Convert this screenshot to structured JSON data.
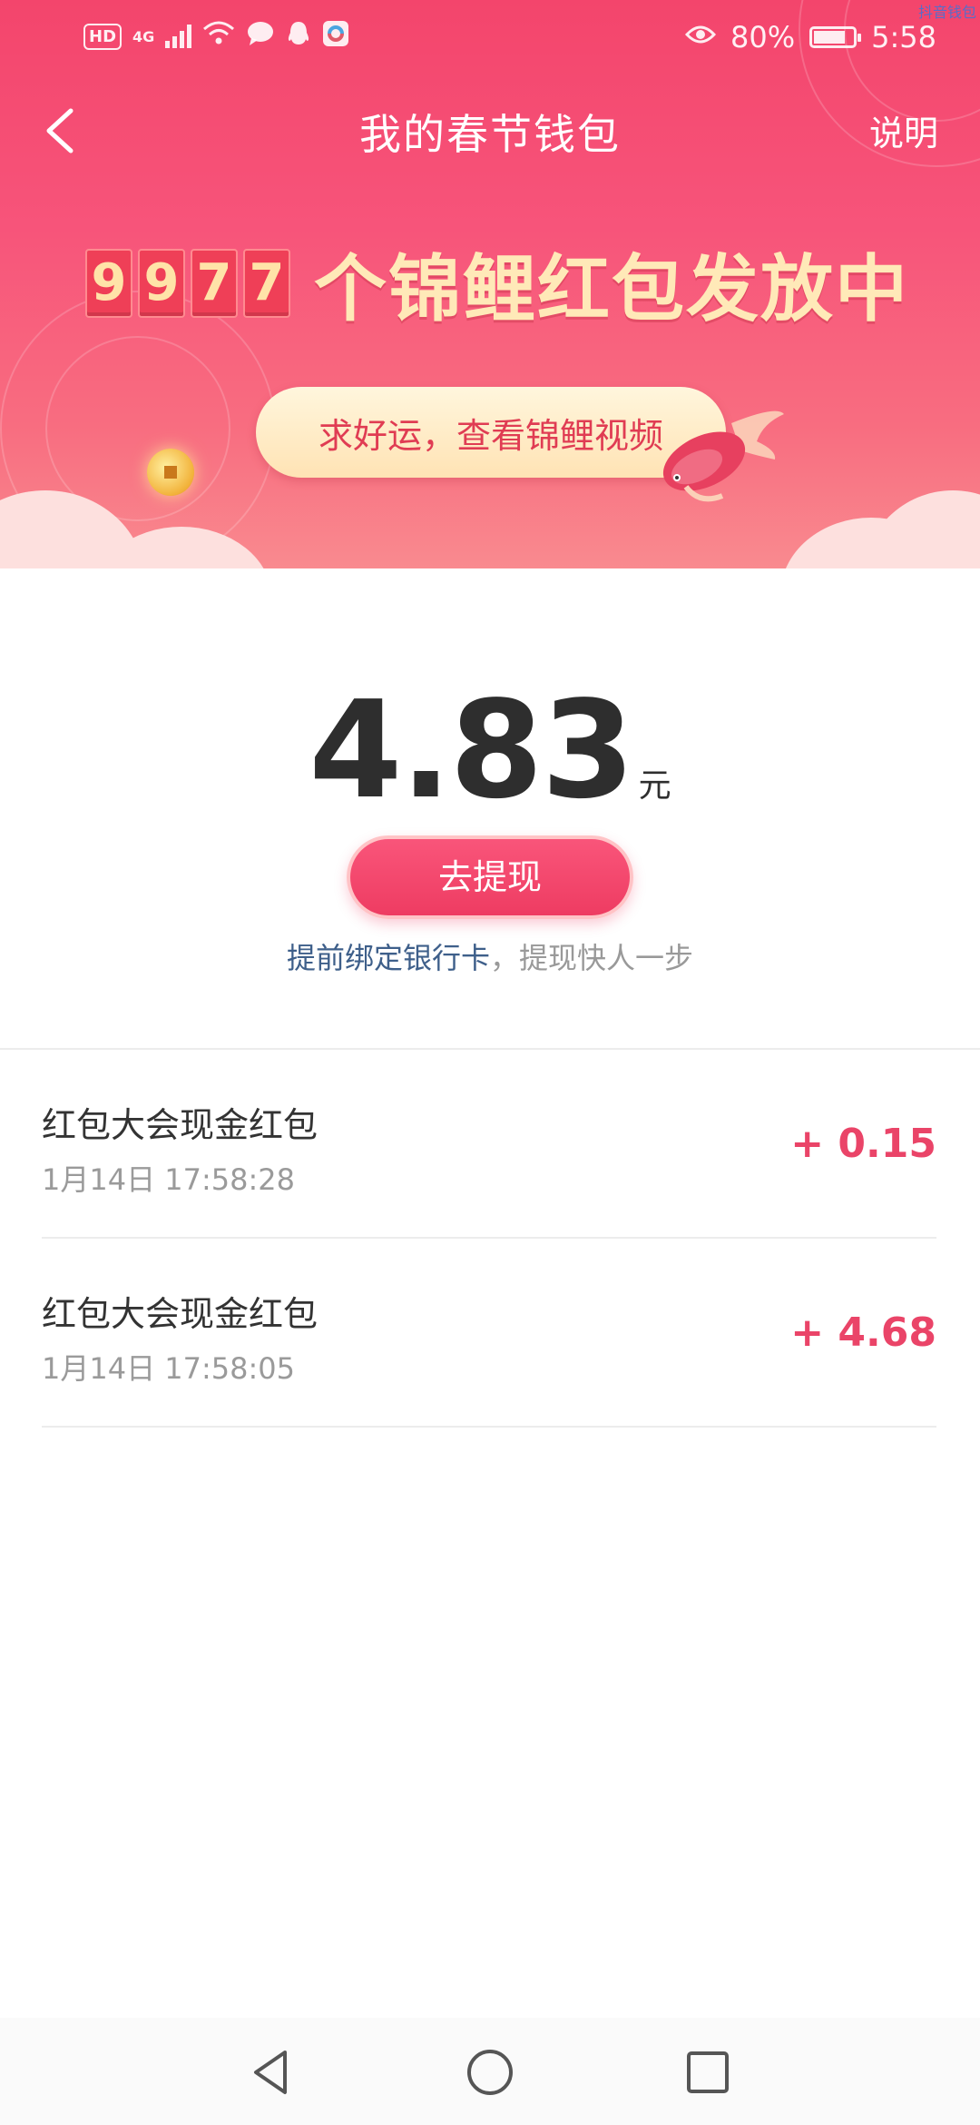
{
  "status_bar": {
    "hd": "HD",
    "network": "4G",
    "battery_percent": "80%",
    "battery_level": 0.8,
    "time": "5:58",
    "corner_tag": "抖音钱包"
  },
  "nav": {
    "title": "我的春节钱包",
    "help_label": "说明"
  },
  "banner": {
    "count_digits": [
      "9",
      "9",
      "7",
      "7"
    ],
    "headline": "个锦鲤红包发放中",
    "video_button": "求好运，查看锦鲤视频"
  },
  "balance": {
    "amount": "4.83",
    "unit": "元",
    "withdraw_label": "去提现",
    "bind_link": "提前绑定银行卡",
    "bind_tip": "，提现快人一步"
  },
  "records": [
    {
      "title": "红包大会现金红包",
      "time": "1月14日 17:58:28",
      "amount": "+ 0.15"
    },
    {
      "title": "红包大会现金红包",
      "time": "1月14日 17:58:05",
      "amount": "+ 4.68"
    }
  ],
  "colors": {
    "banner_top": "#f3456c",
    "accent": "#ea4468",
    "link": "#3e5f8a",
    "headline_gold": "#ffe9b8"
  }
}
